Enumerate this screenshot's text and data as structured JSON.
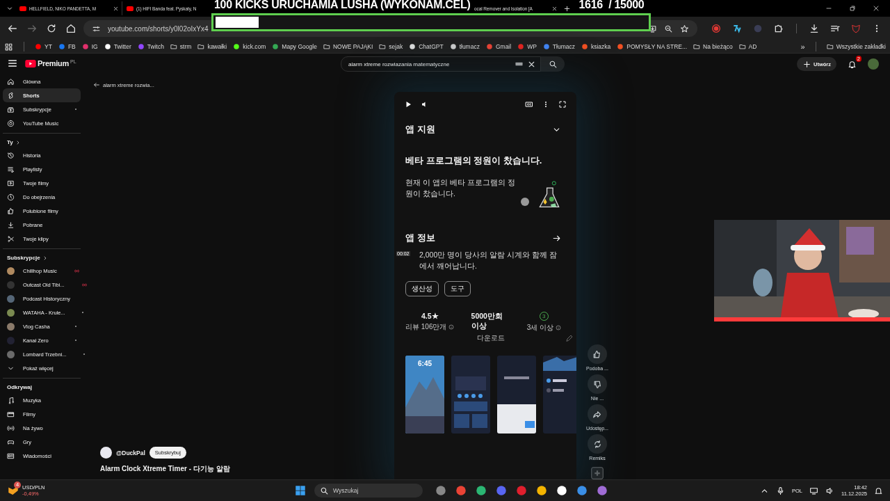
{
  "browser": {
    "tabs": [
      {
        "label": "HELLFIELD, NIKO PANDETTA, M"
      },
      {
        "label": "(1) HIFI Banda feat. Pyskaty, N"
      },
      {
        "label": "ocal Remover and Isolation [A"
      }
    ],
    "address": "youtube.com/shorts/y0l02oIxYx4",
    "bookmarks": [
      {
        "label": "YT",
        "kind": "site"
      },
      {
        "label": "FB",
        "kind": "site"
      },
      {
        "label": "IG",
        "kind": "site"
      },
      {
        "label": "Twitter",
        "kind": "site"
      },
      {
        "label": "Twitch",
        "kind": "site"
      },
      {
        "label": "strm",
        "kind": "folder"
      },
      {
        "label": "kawałki",
        "kind": "folder"
      },
      {
        "label": "kick.com",
        "kind": "site"
      },
      {
        "label": "Mapy Google",
        "kind": "site"
      },
      {
        "label": "NOWE PAJĄKI",
        "kind": "folder"
      },
      {
        "label": "sejak",
        "kind": "folder"
      },
      {
        "label": "ChatGPT",
        "kind": "site"
      },
      {
        "label": "tłumacz",
        "kind": "site"
      },
      {
        "label": "Gmail",
        "kind": "site"
      },
      {
        "label": "WP",
        "kind": "site"
      },
      {
        "label": "Tłumacz",
        "kind": "site"
      },
      {
        "label": "ksiazka",
        "kind": "site"
      },
      {
        "label": "POMYSŁY NA STRE...",
        "kind": "site"
      },
      {
        "label": "Na bieżąco",
        "kind": "folder"
      },
      {
        "label": "AD",
        "kind": "folder"
      }
    ],
    "bookmarks_more": "»",
    "all_bookmarks": "Wszystkie zakładki"
  },
  "stream_overlay": {
    "title": "100 KICKS URUCHAMIA LUSHA (WYKONAM.CEL)",
    "counter": "1616  / 15000",
    "level": 0.1
  },
  "youtube": {
    "logo": "Premium",
    "region": "PL",
    "search": "alarm xtreme rozwiazania matematyczne",
    "create": "Utwórz",
    "notifications": "2",
    "sidebar": {
      "main": [
        {
          "label": "Główna",
          "selected": false
        },
        {
          "label": "Shorts",
          "selected": true
        },
        {
          "label": "Subskrypcje",
          "selected": false
        },
        {
          "label": "YouTube Music",
          "selected": false
        }
      ],
      "you_title": "Ty",
      "you": [
        {
          "label": "Historia"
        },
        {
          "label": "Playlisty"
        },
        {
          "label": "Twoje filmy"
        },
        {
          "label": "Do obejrzenia"
        },
        {
          "label": "Polubione filmy"
        },
        {
          "label": "Pobrane"
        },
        {
          "label": "Twoje klipy"
        }
      ],
      "subs_title": "Subskrypcje",
      "subs": [
        {
          "label": "Chillhop Music",
          "kind": "live"
        },
        {
          "label": "Outcast Old Tibi...",
          "kind": "live"
        },
        {
          "label": "Podcast Historyczny",
          "kind": "plain"
        },
        {
          "label": "WATAHA - Krule...",
          "kind": "new"
        },
        {
          "label": "Vlog Casha",
          "kind": "new"
        },
        {
          "label": "Kanał Zero",
          "kind": "new"
        },
        {
          "label": "Lombard Trzebni...",
          "kind": "new"
        }
      ],
      "show_more": "Pokaż więcej",
      "explore_title": "Odkrywaj",
      "explore": [
        {
          "label": "Muzyka"
        },
        {
          "label": "Filmy"
        },
        {
          "label": "Na żywo"
        },
        {
          "label": "Gry"
        },
        {
          "label": "Wiadomości"
        }
      ]
    },
    "back_link": "alarm xtreme rozwia...",
    "short": {
      "section_1": "앱 지원",
      "beta_title": "베타 프로그램의 정원이 찼습니다.",
      "beta_text": "현재 이 앱의 베타 프로그램의 정원이 찼습니다.",
      "section_2": "앱 정보",
      "about": "2,000만 명이 당사의 알람 시계와 함께 잠에서 깨어납니다.",
      "timestamp": "00:02",
      "tags": [
        "생산성",
        "도구"
      ],
      "stats": [
        {
          "kind": "rating",
          "value": "4.5★",
          "label": "리뷰 106만개"
        },
        {
          "kind": "downloads",
          "value": "5000만회 이상",
          "label": "다운로드"
        },
        {
          "kind": "age",
          "value": "3",
          "label": "3세 이상"
        }
      ],
      "thumbnail_time": "6:45"
    },
    "actions": [
      {
        "label": "Podoba ..."
      },
      {
        "label": "Nie ..."
      },
      {
        "label": "Udostęp..."
      },
      {
        "label": "Remiks"
      }
    ],
    "channel": "@DuckPal",
    "subscribe": "Subskrybuj",
    "title": "Alarm Clock Xtreme Timer - 다기능 알람"
  },
  "taskbar": {
    "widget_badge": "4",
    "widget_title": "USD/PLN",
    "widget_value": "-0,49%",
    "search": "Wyszukaj",
    "language": "POL",
    "time": "18:42",
    "date": "11.12.2025"
  }
}
